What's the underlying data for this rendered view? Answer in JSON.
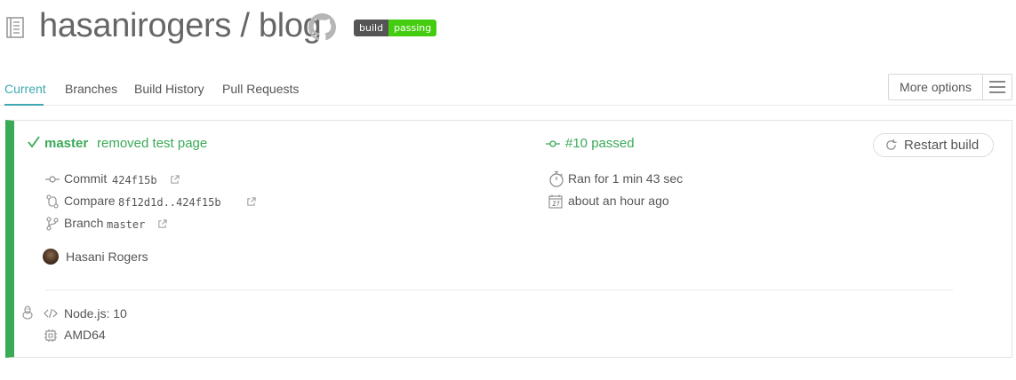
{
  "repo": {
    "owner": "hasanirogers",
    "separator": " / ",
    "name": "blog",
    "badge_left": "build",
    "badge_right": "passing"
  },
  "tabs": [
    {
      "label": "Current",
      "active": true
    },
    {
      "label": "Branches",
      "active": false
    },
    {
      "label": "Build History",
      "active": false
    },
    {
      "label": "Pull Requests",
      "active": false
    }
  ],
  "more_options_label": "More options",
  "build": {
    "branch": "master",
    "message": "removed test page",
    "number_status": "#10 passed",
    "restart_label": "Restart build",
    "commit_label": "Commit",
    "commit_sha": "424f15b",
    "compare_label": "Compare",
    "compare_range": "8f12d1d..424f15b",
    "branch_label": "Branch",
    "branch_value": "master",
    "duration": "Ran for 1 min 43 sec",
    "finished": "about an hour ago",
    "author": "Hasani Rogers",
    "language": "Node.js: 10",
    "arch": "AMD64"
  },
  "colors": {
    "passed_green": "#39aa56",
    "tab_active": "#3ea8b3",
    "badge_passing": "#44cc11",
    "badge_label": "#555555"
  },
  "icons": [
    "repo-icon",
    "github-icon",
    "check-icon",
    "commit-icon",
    "compare-icon",
    "branch-icon",
    "external-link-icon",
    "stopwatch-icon",
    "calendar-icon",
    "restart-icon",
    "linux-icon",
    "code-icon",
    "cpu-icon",
    "hamburger-icon"
  ]
}
